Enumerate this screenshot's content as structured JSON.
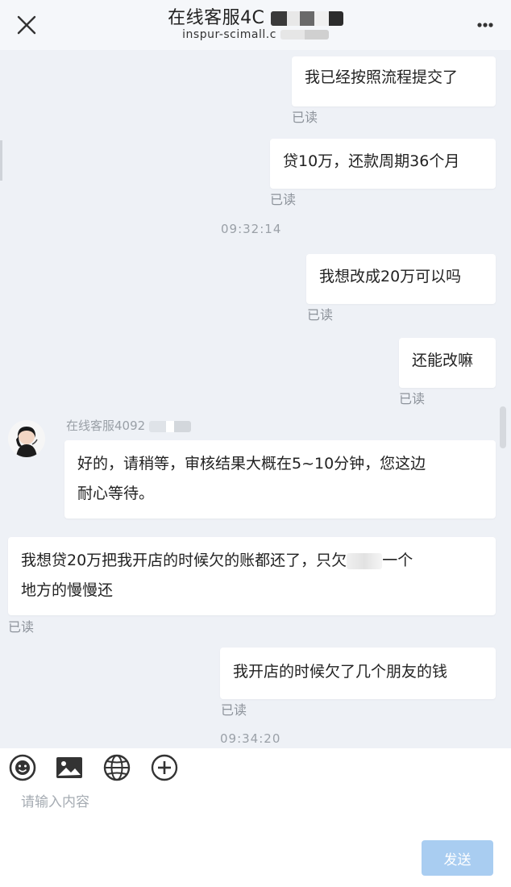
{
  "header": {
    "title": "在线客服4C",
    "subtitle": "inspur-scimall.c"
  },
  "messages": [
    {
      "side": "right",
      "text": "我已经按照流程提交了",
      "status": "已读"
    },
    {
      "side": "right",
      "text": "贷10万，还款周期36个月",
      "status": "已读"
    },
    {
      "type": "time",
      "text": "09:32:14"
    },
    {
      "side": "right",
      "text": "我想改成20万可以吗",
      "status": "已读"
    },
    {
      "side": "right",
      "text": "还能改嘛",
      "status": "已读"
    },
    {
      "side": "left",
      "sender": "在线客服4092",
      "text_line1": "好的，请稍等，审核结果大概在5~10分钟，您这边",
      "text_line2": "耐心等待。"
    },
    {
      "side": "right",
      "text_line1": "我想贷20万把我开店的时候欠的账都还了，只欠",
      "text_line1b": "一个",
      "text_line2": "地方的慢慢还",
      "status": "已读"
    },
    {
      "side": "right",
      "text": "我开店的时候欠了几个朋友的钱",
      "status": "已读"
    },
    {
      "type": "time",
      "text": "09:34:20"
    }
  ],
  "toolbar": {
    "icons": [
      "emoji-icon",
      "image-icon",
      "globe-icon",
      "add-icon"
    ]
  },
  "input": {
    "placeholder": "请输入内容"
  },
  "send": {
    "label": "发送"
  },
  "colors": {
    "background": "#eef1f6",
    "bubble": "#ffffff",
    "send_button": "#a9cdf1",
    "muted_text": "#8d939b"
  }
}
